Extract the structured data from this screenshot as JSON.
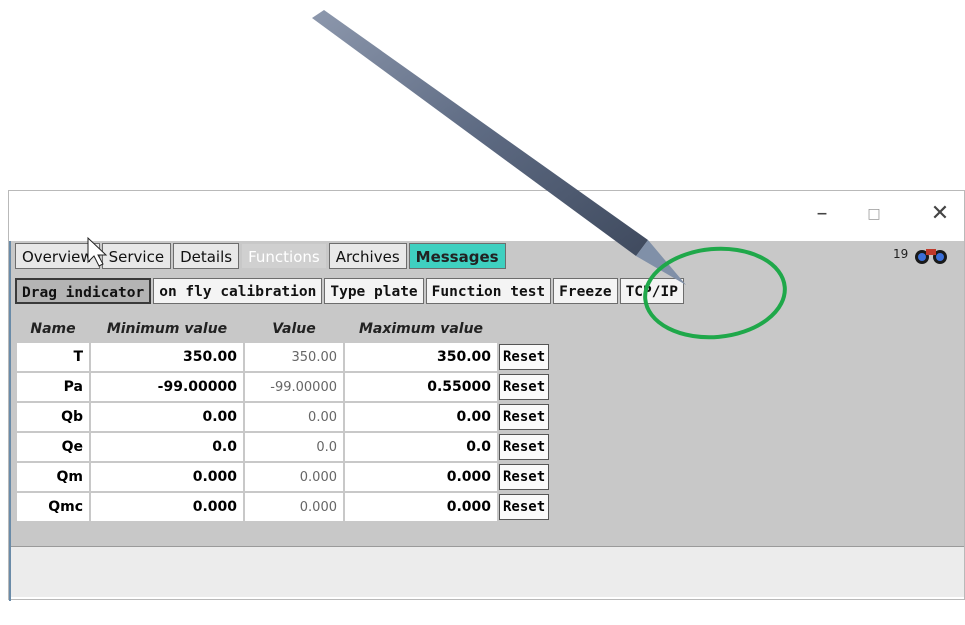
{
  "window": {
    "controls": {
      "minimize": "–",
      "maximize": "□",
      "close": "✕"
    }
  },
  "tabs": [
    {
      "label": "Overview",
      "state": "normal"
    },
    {
      "label": "Service",
      "state": "normal"
    },
    {
      "label": "Details",
      "state": "normal"
    },
    {
      "label": "Functions",
      "state": "active"
    },
    {
      "label": "Archives",
      "state": "normal"
    },
    {
      "label": "Messages",
      "state": "highlight"
    }
  ],
  "status": {
    "text": "19",
    "icon": "binoculars-icon"
  },
  "subtabs": [
    {
      "label": "Drag indicator",
      "state": "active"
    },
    {
      "label": "on fly calibration",
      "state": "normal"
    },
    {
      "label": "Type plate",
      "state": "normal"
    },
    {
      "label": "Function test",
      "state": "normal"
    },
    {
      "label": "Freeze",
      "state": "normal"
    },
    {
      "label": "TCP/IP",
      "state": "normal"
    }
  ],
  "table": {
    "headers": [
      "Name",
      "Minimum value",
      "Value",
      "Maximum value"
    ],
    "rows": [
      {
        "name": "T",
        "min": "350.00",
        "value": "350.00",
        "max": "350.00"
      },
      {
        "name": "Pa",
        "min": "-99.00000",
        "value": "-99.00000",
        "max": "0.55000"
      },
      {
        "name": "Qb",
        "min": "0.00",
        "value": "0.00",
        "max": "0.00"
      },
      {
        "name": "Qe",
        "min": "0.0",
        "value": "0.0",
        "max": "0.0"
      },
      {
        "name": "Qm",
        "min": "0.000",
        "value": "0.000",
        "max": "0.000"
      },
      {
        "name": "Qmc",
        "min": "0.000",
        "value": "0.000",
        "max": "0.000"
      }
    ],
    "reset_label": "Reset"
  },
  "colors": {
    "messages_tab": "#3fd0c0",
    "highlight_circle": "#1fa84a",
    "panel_bg": "#c8c8c8"
  }
}
